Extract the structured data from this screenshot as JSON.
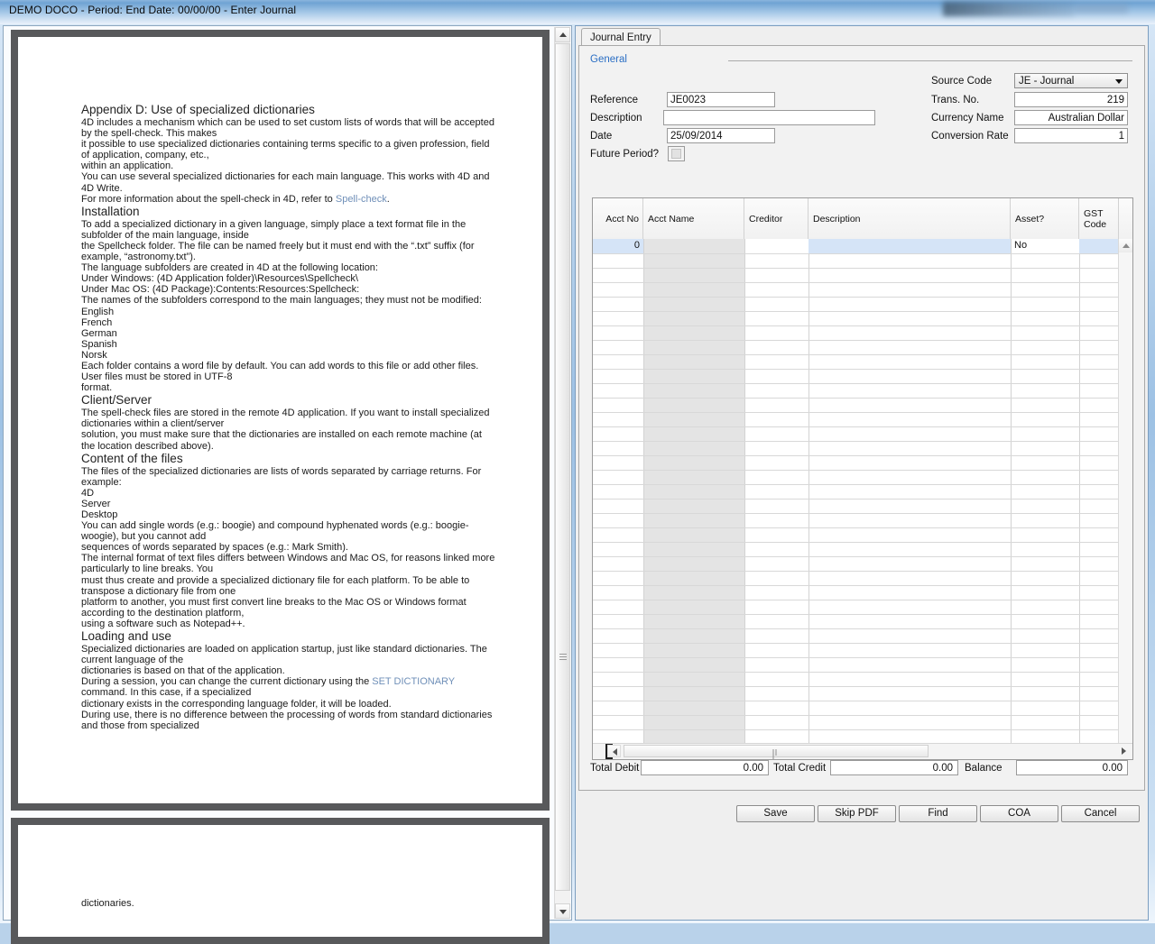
{
  "window": {
    "title": "DEMO DOCO  - Period:   End Date: 00/00/00 - Enter Journal"
  },
  "document_viewer": {
    "page1_heading": "Appendix D: Use of specialized dictionaries",
    "paragraphs": [
      "4D includes a mechanism which can be used to set custom lists of words that will be accepted by the spell-check. This makes",
      "it possible to use specialized dictionaries containing terms specific to a given profession, field of application, company, etc.,",
      "within an application.",
      "You can use several specialized dictionaries for each main language. This works with 4D and 4D Write."
    ],
    "spellcheck_line_prefix": "For more information about the spell-check in 4D, refer to ",
    "spellcheck_link": "Spell-check",
    "spellcheck_line_suffix": ".",
    "h_installation": "Installation",
    "installation_paragraphs": [
      "To add a specialized dictionary in a given language, simply place a text format file in the subfolder of the main language, inside",
      "the Spellcheck folder. The file can be named freely but it must end with the “.txt” suffix (for example, “astronomy.txt”).",
      "The language subfolders are created in 4D at the following location:",
      "Under Windows: (4D Application folder)\\Resources\\Spellcheck\\",
      "Under Mac OS: (4D Package):Contents:Resources:Spellcheck:",
      "The names of the subfolders correspond to the main languages; they must not be modified:",
      "English",
      "French",
      "German",
      "Spanish",
      "Norsk",
      "Each folder contains a word file by default. You can add words to this file or add other files. User files must be stored in UTF-8",
      "format."
    ],
    "h_client_server": "Client/Server",
    "client_server_paragraphs": [
      "The spell-check files are stored in the remote 4D application. If you want to install specialized dictionaries within a client/server",
      "solution, you must make sure that the dictionaries are installed on each remote machine (at the location described above)."
    ],
    "h_content": "Content of the files",
    "content_paragraphs": [
      "The files of the specialized dictionaries are lists of words separated by carriage returns. For example:",
      "4D",
      "Server",
      "Desktop",
      "You can add single words (e.g.: boogie) and compound hyphenated words (e.g.: boogie-woogie), but you cannot add",
      "sequences of words separated by spaces (e.g.: Mark Smith).",
      "The internal format of text files differs between Windows and Mac OS, for reasons linked more particularly to line breaks. You",
      "must thus create and provide a specialized dictionary file for each platform. To be able to transpose a dictionary file from one",
      "platform to another, you must first convert line breaks to the Mac OS or Windows format according to the destination platform,",
      "using a software such as Notepad++."
    ],
    "h_loading": "Loading and use",
    "loading_paragraphs": [
      "Specialized dictionaries are loaded on application startup, just like standard dictionaries. The current language of the",
      "dictionaries is based on that of the application."
    ],
    "session_line_prefix": "During a session, you can change the current dictionary using the ",
    "session_link": "SET DICTIONARY",
    "session_line_suffix": " command. In this case, if a specialized",
    "loading_paragraphs2": [
      "dictionary exists in the corresponding language folder, it will be loaded.",
      "During use, there is no difference between the processing of words from standard dictionaries and those from specialized"
    ],
    "page2_text": "dictionaries."
  },
  "form": {
    "tab_label": "Journal Entry",
    "section_label": "General",
    "fields": {
      "reference_label": "Reference",
      "reference_value": "JE0023",
      "description_label": "Description",
      "description_value": "",
      "date_label": "Date",
      "date_value": "25/09/2014",
      "future_period_label": "Future Period?",
      "source_code_label": "Source Code",
      "source_code_value": "JE - Journal",
      "trans_no_label": "Trans. No.",
      "trans_no_value": "219",
      "currency_name_label": "Currency Name",
      "currency_name_value": "Australian Dollar",
      "conversion_rate_label": "Conversion Rate",
      "conversion_rate_value": "1"
    },
    "grid": {
      "columns": [
        "Acct No",
        "Acct Name",
        "Creditor",
        "Description",
        "Asset?",
        "GST Code"
      ],
      "rows": [
        {
          "acct_no": "0",
          "acct_name": "",
          "creditor": "",
          "description": "",
          "asset": "No",
          "gst_code": ""
        }
      ]
    },
    "totals": {
      "total_debit_label": "Total Debit",
      "total_debit_value": "0.00",
      "total_credit_label": "Total Credit",
      "total_credit_value": "0.00",
      "balance_label": "Balance",
      "balance_value": "0.00"
    },
    "buttons": {
      "save": "Save",
      "skip_pdf": "Skip PDF",
      "find": "Find",
      "coa": "COA",
      "cancel": "Cancel"
    }
  },
  "colors": {
    "accent_blue": "#2a6ec4",
    "selection_blue": "#d5e4f7",
    "title_blue": "#6fa3d3"
  }
}
